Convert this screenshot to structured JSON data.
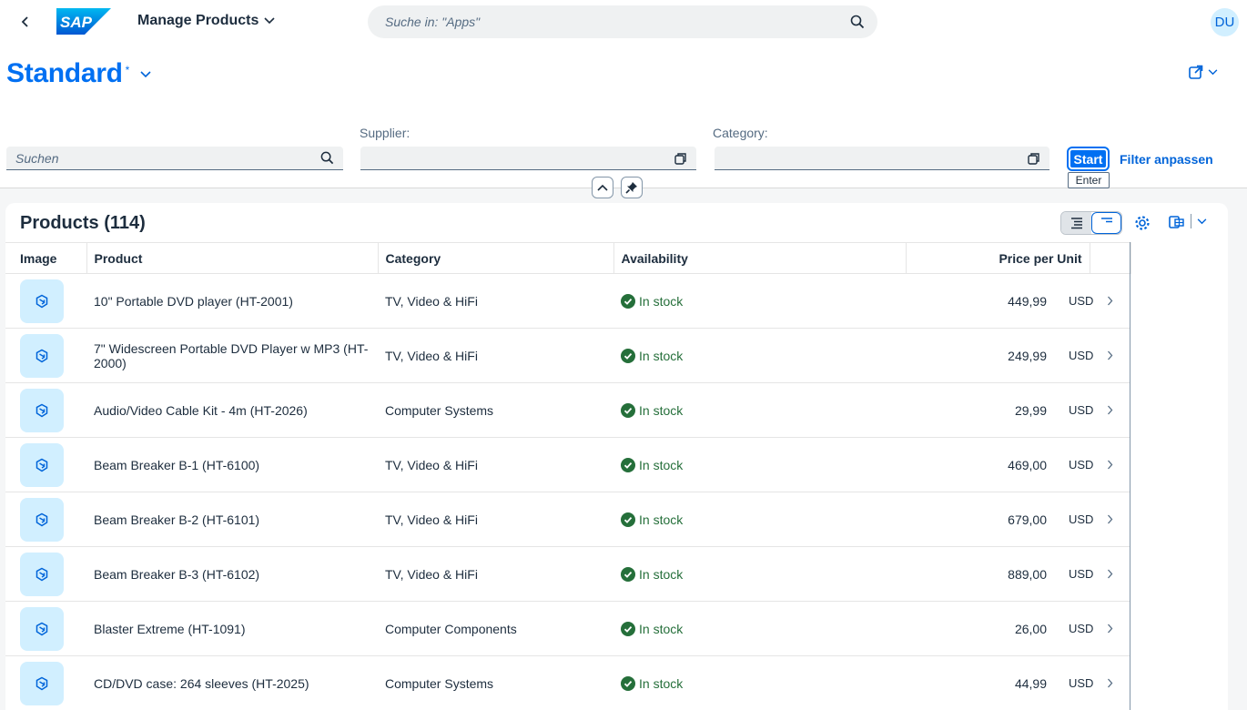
{
  "shell": {
    "app_title": "Manage Products",
    "search_placeholder": "Suche in: \"Apps\"",
    "avatar_initials": "DU",
    "logo_text": "SAP"
  },
  "header": {
    "variant_title": "Standard",
    "variant_modified": "*"
  },
  "filters": {
    "search_placeholder": "Suchen",
    "supplier_label": "Supplier:",
    "supplier_value": "",
    "category_label": "Category:",
    "category_value": "",
    "start_label": "Start",
    "enter_tooltip": "Enter",
    "adapt_label": "Filter anpassen"
  },
  "table": {
    "title": "Products (114)",
    "columns": {
      "image": "Image",
      "product": "Product",
      "category": "Category",
      "availability": "Availability",
      "price": "Price per Unit"
    },
    "rows": [
      {
        "product": "10\" Portable DVD player (HT-2001)",
        "category": "TV, Video & HiFi",
        "availability": "In stock",
        "price": "449,99",
        "currency": "USD"
      },
      {
        "product": "7\" Widescreen Portable DVD Player w MP3 (HT-2000)",
        "category": "TV, Video & HiFi",
        "availability": "In stock",
        "price": "249,99",
        "currency": "USD"
      },
      {
        "product": "Audio/Video Cable Kit - 4m (HT-2026)",
        "category": "Computer Systems",
        "availability": "In stock",
        "price": "29,99",
        "currency": "USD"
      },
      {
        "product": "Beam Breaker B-1 (HT-6100)",
        "category": "TV, Video & HiFi",
        "availability": "In stock",
        "price": "469,00",
        "currency": "USD"
      },
      {
        "product": "Beam Breaker B-2 (HT-6101)",
        "category": "TV, Video & HiFi",
        "availability": "In stock",
        "price": "679,00",
        "currency": "USD"
      },
      {
        "product": "Beam Breaker B-3 (HT-6102)",
        "category": "TV, Video & HiFi",
        "availability": "In stock",
        "price": "889,00",
        "currency": "USD"
      },
      {
        "product": "Blaster Extreme (HT-1091)",
        "category": "Computer Components",
        "availability": "In stock",
        "price": "26,00",
        "currency": "USD"
      },
      {
        "product": "CD/DVD case: 264 sleeves (HT-2025)",
        "category": "Computer Systems",
        "availability": "In stock",
        "price": "44,99",
        "currency": "USD"
      }
    ]
  },
  "colors": {
    "accent": "#0070f2",
    "success": "#256f3a",
    "thumb_bg": "#d1efff"
  }
}
